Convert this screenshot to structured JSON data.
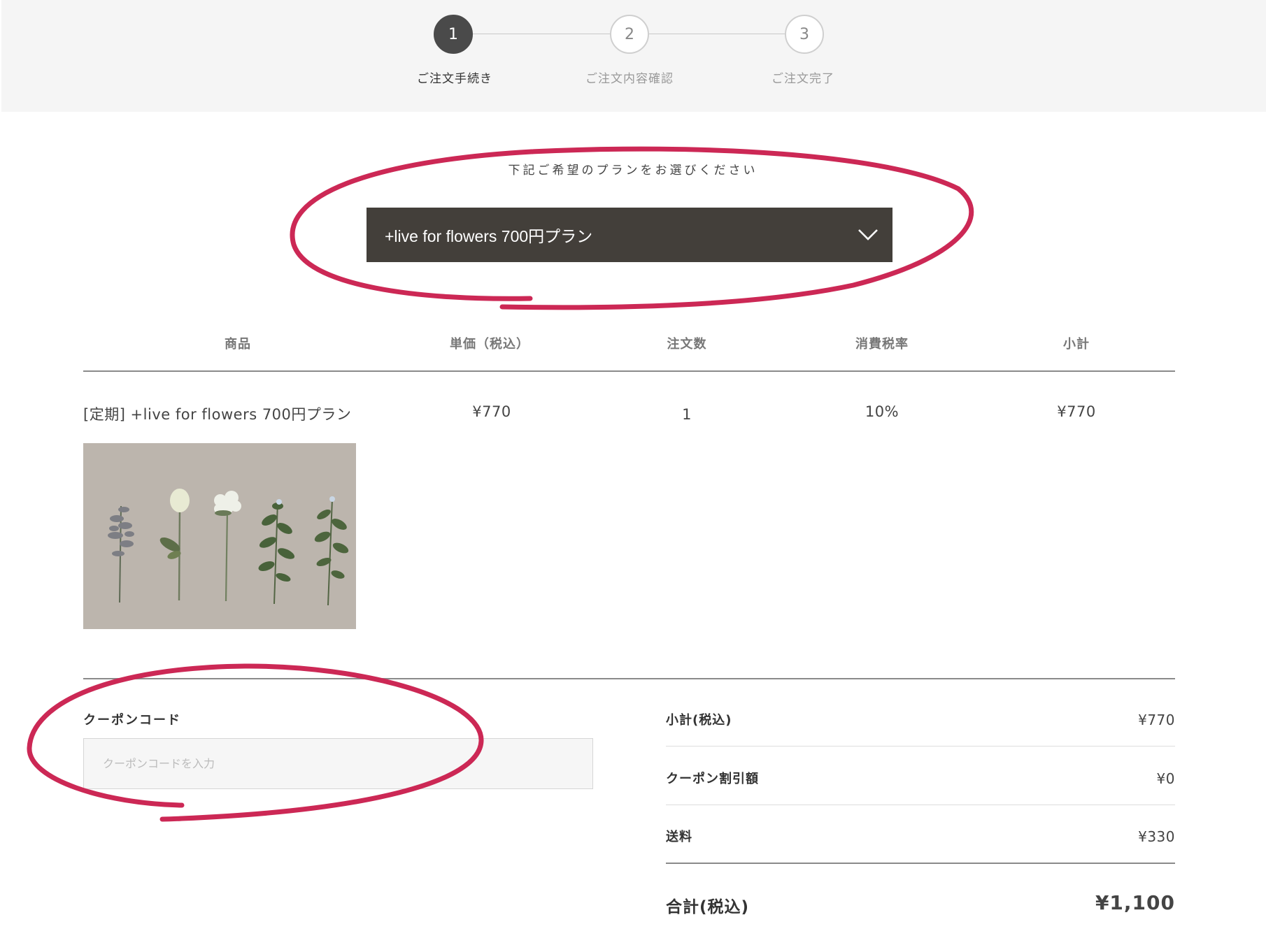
{
  "steps": [
    {
      "number": "1",
      "label": "ご注文手続き",
      "active": true
    },
    {
      "number": "2",
      "label": "ご注文内容確認",
      "active": false
    },
    {
      "number": "3",
      "label": "ご注文完了",
      "active": false
    }
  ],
  "plan": {
    "heading": "下記ご希望のプランをお選びください",
    "selected": "+live for flowers 700円プラン"
  },
  "table": {
    "headers": [
      "商品",
      "単価（税込）",
      "注文数",
      "消費税率",
      "小計"
    ],
    "row": {
      "product": "[定期] +live for flowers 700円プラン",
      "unit_price": "¥770",
      "quantity": "1",
      "tax_rate": "10%",
      "subtotal": "¥770"
    }
  },
  "coupon": {
    "label": "クーポンコード",
    "placeholder": "クーポンコードを入力",
    "value": ""
  },
  "summary": {
    "subtotal_label": "小計(税込)",
    "subtotal_value": "¥770",
    "discount_label": "クーポン割引額",
    "discount_value": "¥0",
    "shipping_label": "送料",
    "shipping_value": "¥330",
    "total_label": "合計(税込)",
    "total_value": "¥1,100"
  },
  "colors": {
    "annotation": "#cc2855",
    "select_bg": "#433f3a",
    "step_active": "#4a4a4a"
  },
  "icons": {
    "select_arrow": "chevron-down-icon"
  }
}
